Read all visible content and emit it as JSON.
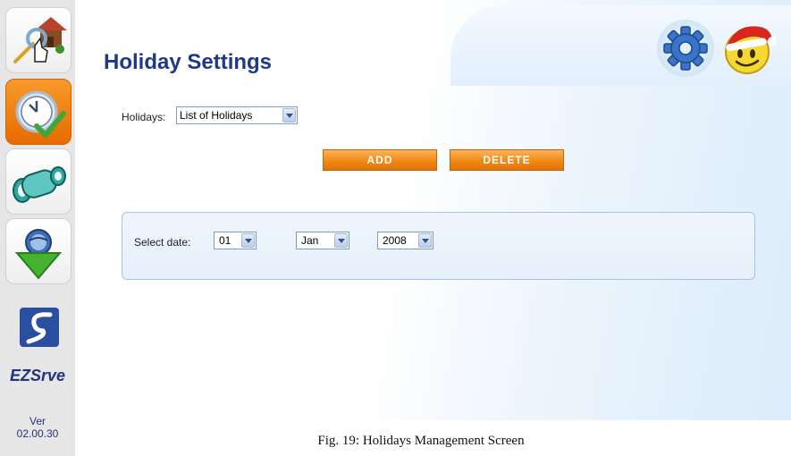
{
  "sidebar": {
    "items": [
      {
        "name": "home",
        "icon": "house-hand-icon",
        "active": false
      },
      {
        "name": "holidays",
        "icon": "clock-check-icon",
        "active": true
      },
      {
        "name": "monitor",
        "icon": "binoculars-icon",
        "active": false
      },
      {
        "name": "download",
        "icon": "globe-download-icon",
        "active": false
      }
    ],
    "logo_icon": "s-logo-icon",
    "brand": "EZSrve",
    "version_label": "Ver",
    "version_number": "02.00.30"
  },
  "header": {
    "title": "Holiday Settings",
    "settings_icon": "gear-icon",
    "user_icon": "santa-smiley-icon"
  },
  "holidays": {
    "label": "Holidays:",
    "selected": "List of Holidays"
  },
  "buttons": {
    "add": "ADD",
    "delete": "DELETE"
  },
  "date": {
    "label": "Select date:",
    "day": "01",
    "month": "Jan",
    "year": "2008"
  },
  "caption": "Fig. 19: Holidays Management Screen",
  "colors": {
    "accent_orange": "#f08a14",
    "title_blue": "#1e3a86",
    "panel_border": "#a9c1dd"
  }
}
